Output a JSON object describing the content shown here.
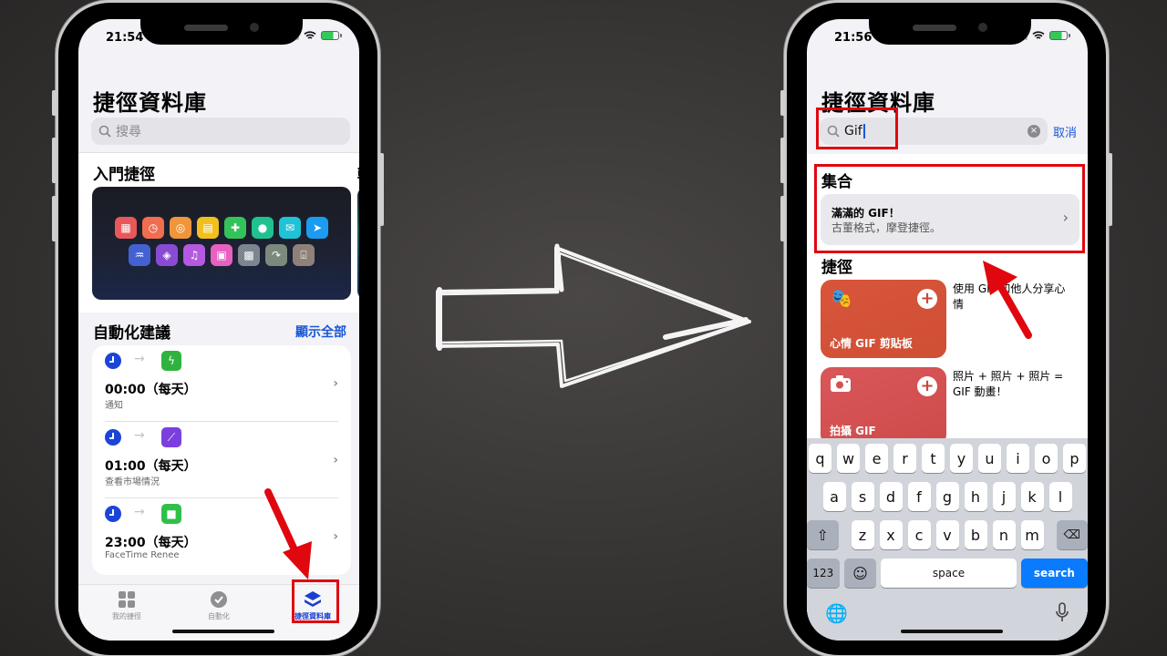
{
  "left_phone": {
    "status": {
      "time": "21:54"
    },
    "title": "捷徑資料庫",
    "search": {
      "placeholder": "搜尋"
    },
    "starter_section": {
      "title": "入門捷徑",
      "next_peek": "輕"
    },
    "hero_tiles": [
      [
        {
          "icon": "calendar-icon",
          "color": "#e8585a",
          "glyph": "▦"
        },
        {
          "icon": "timer-icon",
          "color": "#f06d4f",
          "glyph": "◷"
        },
        {
          "icon": "airdrop-icon",
          "color": "#f0953b",
          "glyph": "◎"
        },
        {
          "icon": "note-add-icon",
          "color": "#f2c01e",
          "glyph": "▤"
        },
        {
          "icon": "message-add-icon",
          "color": "#34c35a",
          "glyph": "✚"
        },
        {
          "icon": "chat-bubble-icon",
          "color": "#1fc28f",
          "glyph": "●"
        },
        {
          "icon": "mail-icon",
          "color": "#1fc2d6",
          "glyph": "✉"
        },
        {
          "icon": "send-icon",
          "color": "#1c9cf0",
          "glyph": "➤"
        }
      ],
      [
        {
          "icon": "waveform-icon",
          "color": "#4461d4",
          "glyph": "♒"
        },
        {
          "icon": "layers-icon",
          "color": "#8a4bd4",
          "glyph": "◈"
        },
        {
          "icon": "music-list-icon",
          "color": "#b45ae0",
          "glyph": "♫"
        },
        {
          "icon": "photos-icon",
          "color": "#e860c0",
          "glyph": "▣"
        },
        {
          "icon": "qr-code-icon",
          "color": "#7c8691",
          "glyph": "▩"
        },
        {
          "icon": "share-icon",
          "color": "#7c8a7e",
          "glyph": "↷"
        },
        {
          "icon": "scan-icon",
          "color": "#8f8179",
          "glyph": "⌻"
        }
      ]
    ],
    "automation_section": {
      "title": "自動化建議",
      "show_all": "顯示全部"
    },
    "automations": [
      {
        "time": "00:00（每天）",
        "subtitle": "通知",
        "app_icon": "power-icon",
        "app_color": "#2fb33f",
        "glyph": "ϟ"
      },
      {
        "time": "01:00（每天）",
        "subtitle": "查看市場情況",
        "app_icon": "stocks-icon",
        "app_color": "#7b3fe0",
        "glyph": "⟋"
      },
      {
        "time": "23:00（每天）",
        "subtitle": "FaceTime Renee",
        "app_icon": "facetime-icon",
        "app_color": "#30c04a",
        "glyph": "■"
      }
    ],
    "tabs": [
      {
        "label": "我的捷徑",
        "icon": "grid-icon",
        "active": false
      },
      {
        "label": "自動化",
        "icon": "clock-check-icon",
        "active": false
      },
      {
        "label": "捷徑資料庫",
        "icon": "stack-icon",
        "active": true
      }
    ]
  },
  "right_phone": {
    "status": {
      "time": "21:56"
    },
    "title": "捷徑資料庫",
    "search": {
      "value": "Gif",
      "cancel": "取消"
    },
    "collections_section": {
      "title": "集合"
    },
    "collection": {
      "title": "滿滿的 GIF！",
      "subtitle": "古董格式，摩登捷徑。"
    },
    "shortcuts_section": {
      "title": "捷徑"
    },
    "shortcuts": [
      {
        "name": "心情 GIF 剪貼板",
        "description": "使用 GIF 和他人分享心情",
        "icon": "theater-masks-icon",
        "color": "#d9573a"
      },
      {
        "name": "拍攝 GIF",
        "description": "照片 + 照片 + 照片 = GIF 動畫！",
        "icon": "camera-icon",
        "color": "#d8504e"
      }
    ],
    "keyboard": {
      "row1": [
        "q",
        "w",
        "e",
        "r",
        "t",
        "y",
        "u",
        "i",
        "o",
        "p"
      ],
      "row2": [
        "a",
        "s",
        "d",
        "f",
        "g",
        "h",
        "j",
        "k",
        "l"
      ],
      "row3": [
        "z",
        "x",
        "c",
        "v",
        "b",
        "n",
        "m"
      ],
      "numbers": "123",
      "space": "space",
      "search": "search"
    }
  },
  "annotations": {
    "highlight_color": "#e0070f"
  }
}
